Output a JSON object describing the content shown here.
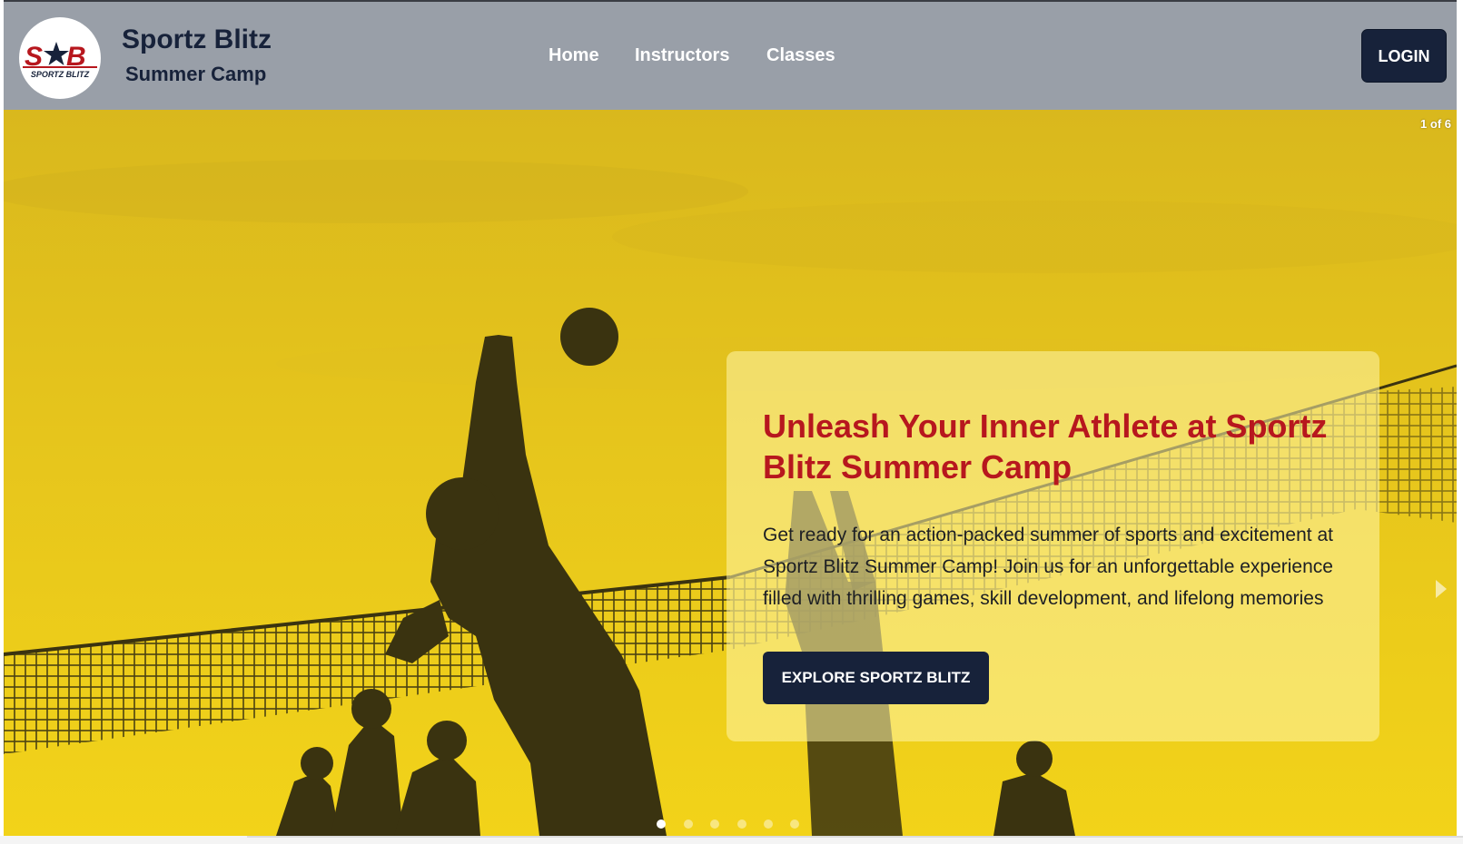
{
  "header": {
    "brand_title": "Sportz Blitz",
    "brand_subtitle": "Summer Camp",
    "logo_text": "SPORTZ BLITZ",
    "logo_monogram": "S★B",
    "nav": [
      {
        "label": "Home"
      },
      {
        "label": "Instructors"
      },
      {
        "label": "Classes"
      }
    ],
    "login_label": "LOGIN"
  },
  "hero": {
    "slide_counter": "1 of 6",
    "title": "Unleash Your Inner Athlete at Sportz Blitz Summer Camp",
    "body": "Get ready for an action-packed summer of sports and excitement at Sportz Blitz Summer Camp! Join us for an unforgettable experience filled with thrilling games, skill development, and lifelong memories",
    "cta_label": "EXPLORE SPORTZ BLITZ",
    "slides_total": 6,
    "active_slide": 1
  },
  "colors": {
    "header_bg": "#999fa8",
    "navy": "#17223a",
    "title_red": "#b7171e",
    "hero_yellow": "#e8c619",
    "silhouette": "#3a3310"
  },
  "icons": {
    "logo": "sportz-blitz-logo",
    "next": "chevron-right-icon"
  }
}
